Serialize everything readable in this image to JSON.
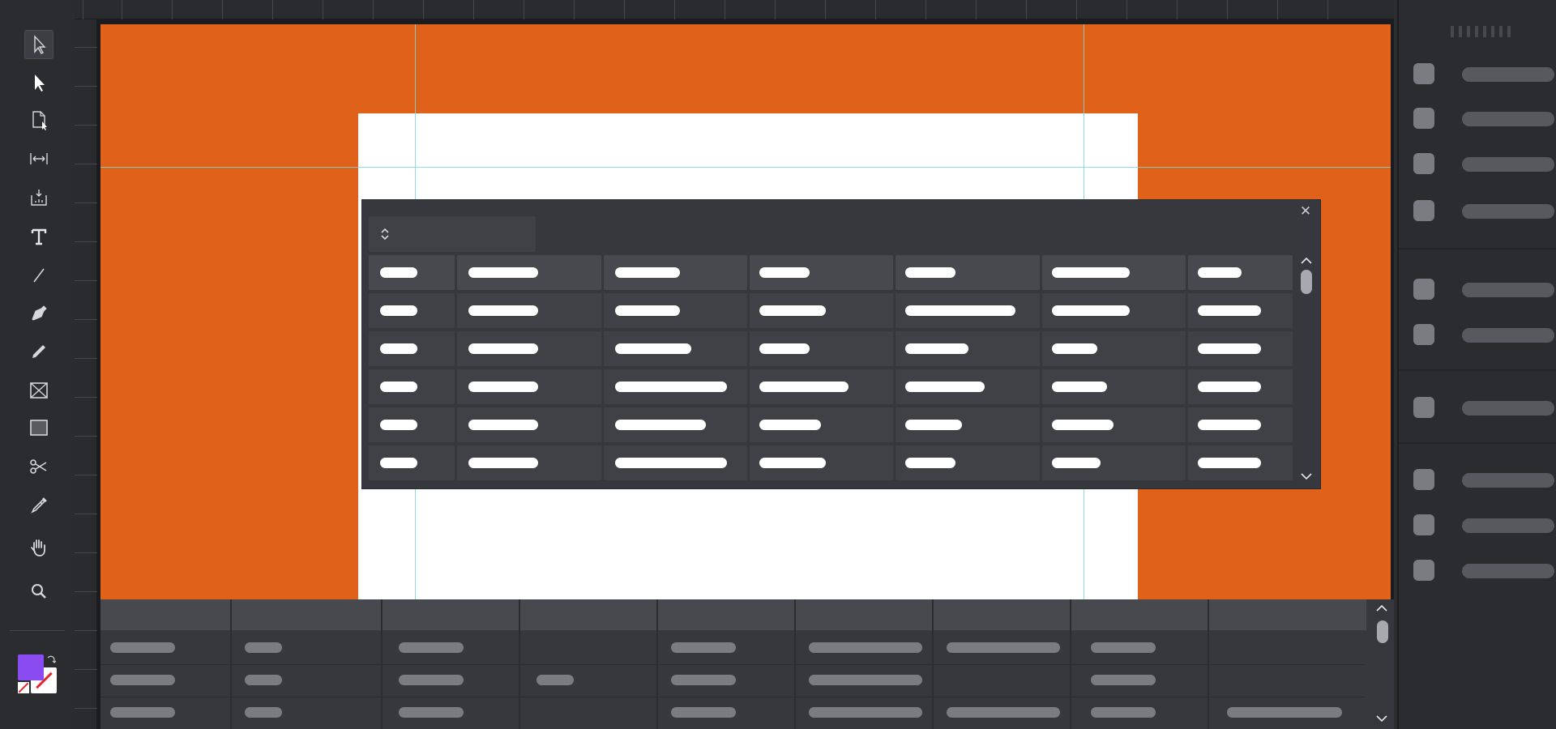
{
  "app": {
    "toolbar": {
      "tools": [
        {
          "name": "selection-tool-icon",
          "active": true
        },
        {
          "name": "direct-selection-tool-icon",
          "active": false
        },
        {
          "name": "page-tool-icon",
          "active": false
        },
        {
          "name": "gap-tool-icon",
          "active": false
        },
        {
          "name": "content-collector-icon",
          "active": false
        },
        {
          "name": "type-tool-icon",
          "active": false
        },
        {
          "name": "line-tool-icon",
          "active": false
        },
        {
          "name": "pen-tool-icon",
          "active": false
        },
        {
          "name": "pencil-tool-icon",
          "active": false
        },
        {
          "name": "rectangle-frame-tool-icon",
          "active": false
        },
        {
          "name": "rectangle-tool-icon",
          "active": false
        },
        {
          "name": "scissors-tool-icon",
          "active": false
        },
        {
          "name": "eyedropper-tool-icon",
          "active": false
        },
        {
          "name": "hand-tool-icon",
          "active": false
        },
        {
          "name": "zoom-tool-icon",
          "active": false
        }
      ],
      "fill_color": "#8a4cf0",
      "stroke_color": "#ffffff"
    },
    "canvas": {
      "pasteboard_color": "#e0621a",
      "page_color": "#ffffff",
      "guide_color": "#7fd6de"
    },
    "dialog": {
      "close_glyph": "✕",
      "selected_option": ""
    }
  }
}
